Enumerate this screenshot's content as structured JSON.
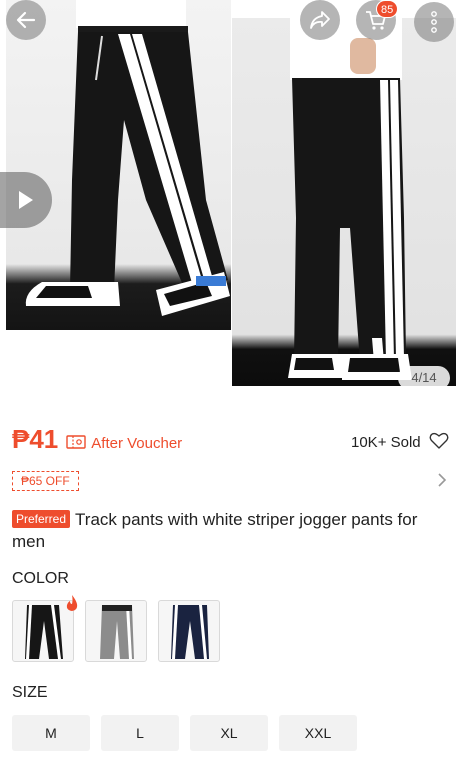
{
  "header": {
    "cart_count": "85",
    "image_counter": "4/14"
  },
  "product": {
    "price": "₱41",
    "voucher_text": "After Voucher",
    "sold_text": "10K+ Sold",
    "off_tag": "₱65 OFF",
    "preferred_badge": "Preferred",
    "title": "Track pants with white striper jogger pants for men"
  },
  "variations": {
    "color_label": "COLOR",
    "size_label": "SIZE",
    "sizes": [
      "M",
      "L",
      "XL",
      "XXL"
    ]
  },
  "colors": {
    "accent": "#ee4d2d",
    "pants": "#161616",
    "stripe": "#ffffff"
  },
  "icons": [
    "back-arrow-icon",
    "share-icon",
    "cart-icon",
    "more-icon",
    "play-icon",
    "heart-icon",
    "voucher-icon",
    "chevron-right-icon",
    "fire-icon"
  ]
}
